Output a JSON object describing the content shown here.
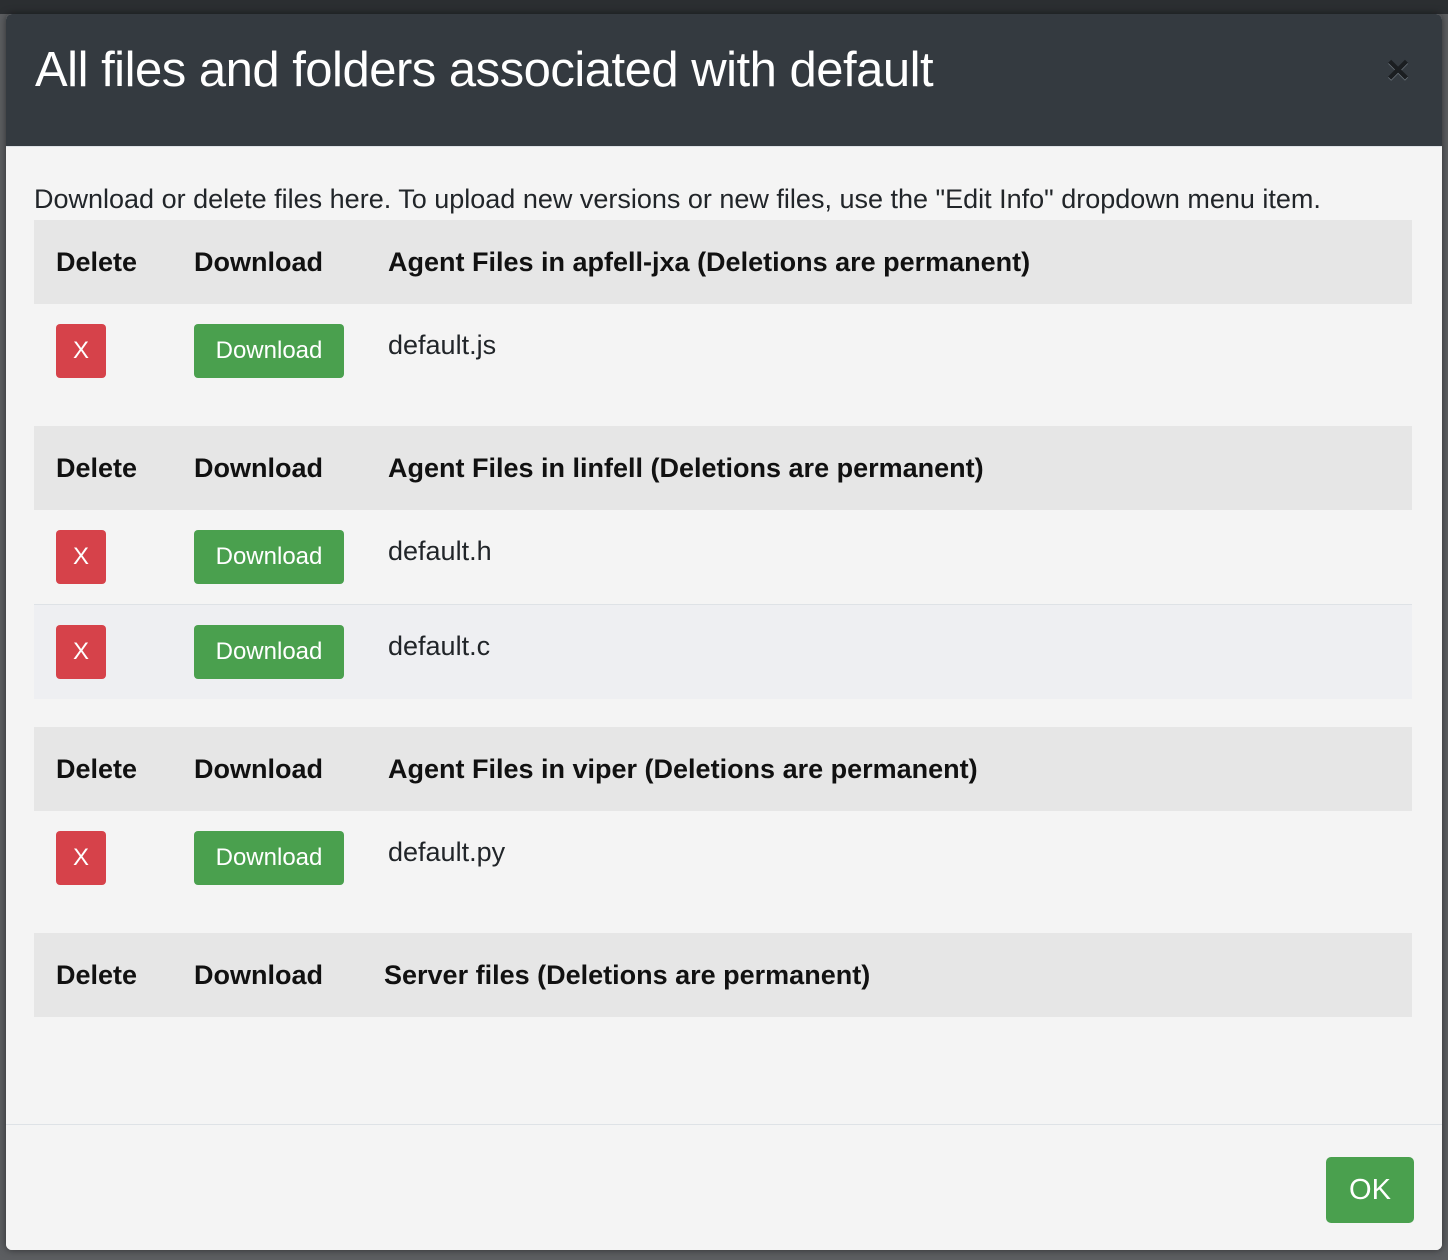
{
  "modal": {
    "title": "All files and folders associated with default",
    "close_label": "×",
    "intro": "Download or delete files here. To upload new versions or new files, use the \"Edit Info\" dropdown menu item.",
    "ok_label": "OK"
  },
  "sections": [
    {
      "col_delete": "Delete",
      "col_download": "Download",
      "heading": "Agent Files in apfell-jxa (Deletions are permanent)",
      "files": [
        {
          "delete_label": "X",
          "download_label": "Download",
          "name": "default.js"
        }
      ]
    },
    {
      "col_delete": "Delete",
      "col_download": "Download",
      "heading": "Agent Files in linfell (Deletions are permanent)",
      "files": [
        {
          "delete_label": "X",
          "download_label": "Download",
          "name": "default.h"
        },
        {
          "delete_label": "X",
          "download_label": "Download",
          "name": "default.c"
        }
      ]
    },
    {
      "col_delete": "Delete",
      "col_download": "Download",
      "heading": "Agent Files in viper (Deletions are permanent)",
      "files": [
        {
          "delete_label": "X",
          "download_label": "Download",
          "name": "default.py"
        }
      ]
    },
    {
      "col_delete": "Delete",
      "col_download": "Download",
      "heading": "Server files (Deletions are permanent)",
      "files": []
    }
  ],
  "colors": {
    "header_bg": "#343a40",
    "danger": "#d6424a",
    "success": "#4aa04e",
    "table_head_bg": "#e6e6e6"
  }
}
